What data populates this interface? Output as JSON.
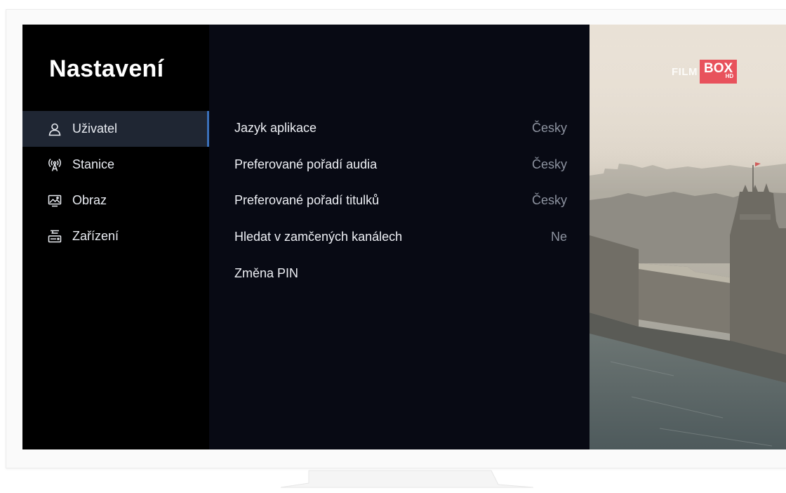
{
  "sidebar": {
    "title": "Nastavení",
    "items": [
      {
        "label": "Uživatel",
        "icon": "user-icon",
        "active": true
      },
      {
        "label": "Stanice",
        "icon": "antenna-icon",
        "active": false
      },
      {
        "label": "Obraz",
        "icon": "picture-icon",
        "active": false
      },
      {
        "label": "Zařízení",
        "icon": "device-icon",
        "active": false
      }
    ]
  },
  "settings": [
    {
      "label": "Jazyk aplikace",
      "value": "Česky"
    },
    {
      "label": "Preferované pořadí audia",
      "value": "Česky"
    },
    {
      "label": "Preferované pořadí titulků",
      "value": "Česky"
    },
    {
      "label": "Hledat v zamčených kanálech",
      "value": "Ne"
    },
    {
      "label": "Změna PIN",
      "value": ""
    }
  ],
  "preview": {
    "logo_left": "FILM",
    "logo_box": "BOX",
    "logo_badge": "HD"
  },
  "colors": {
    "accent": "#3a6fb8",
    "active_bg": "#1f2633",
    "logo_red": "#e8525c"
  }
}
